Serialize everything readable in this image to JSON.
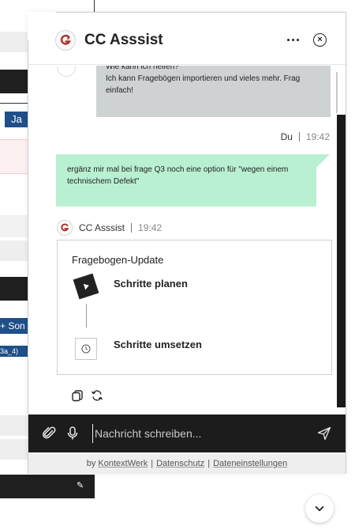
{
  "background_page": {
    "tag_ja": "Ja",
    "tag_son": "+ Son",
    "tag_small": "3a_4)"
  },
  "header": {
    "title": "CC Asssist",
    "more_icon": "more-horizontal-icon",
    "close_icon": "close-circle-icon",
    "close_glyph": "×"
  },
  "messages": {
    "bot_intro": {
      "line1": "Wie kann ich helfen?",
      "line2": "Ich kann Fragebögen importieren und vieles mehr. Frag einfach!"
    },
    "user": {
      "name": "Du",
      "time": "19:42",
      "text": "ergänz mir mal bei frage Q3 noch eine option für \"wegen einem technischem Defekt\""
    },
    "bot": {
      "name": "CC Asssist",
      "time": "19:42",
      "card": {
        "title": "Fragebogen-Update",
        "steps": [
          {
            "label": "Schritte planen",
            "icon": "play-icon",
            "state": "active"
          },
          {
            "label": "Schritte umsetzen",
            "icon": "clock-icon",
            "state": "pending"
          }
        ]
      },
      "actions": [
        "copy-icon",
        "refresh-icon"
      ]
    }
  },
  "composer": {
    "placeholder": "Nachricht schreiben...",
    "value": ""
  },
  "footer": {
    "by": "by",
    "brand": "KontextWerk",
    "privacy": "Datenschutz",
    "settings": "Dateneinstellungen",
    "separator": "|"
  },
  "colors": {
    "user_bubble": "#b9f0d2",
    "bot_bubble": "#ced2d3",
    "composer_bg": "#1c1c1c",
    "accent_logo": "#b0312a"
  }
}
